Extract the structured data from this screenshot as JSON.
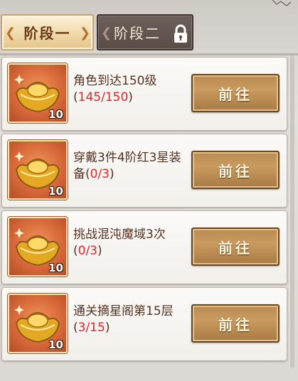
{
  "tabs": [
    {
      "label": "阶段一",
      "active": true,
      "locked": false
    },
    {
      "label": "阶段二",
      "active": false,
      "locked": true
    }
  ],
  "tasks": [
    {
      "text": "角色到达150级",
      "progress_text": "145/150",
      "progress_value": 145,
      "progress_max": 150,
      "reward": {
        "icon": "gold-ingot-icon",
        "count": "10"
      },
      "button": "前往"
    },
    {
      "text": "穿戴3件4阶红3星装备",
      "progress_text": "0/3",
      "progress_value": 0,
      "progress_max": 3,
      "reward": {
        "icon": "gold-ingot-icon",
        "count": "10"
      },
      "button": "前往"
    },
    {
      "text": "挑战混沌魔域3次",
      "progress_text": "0/3",
      "progress_value": 0,
      "progress_max": 3,
      "reward": {
        "icon": "gold-ingot-icon",
        "count": "10"
      },
      "button": "前往"
    },
    {
      "text": "通关摘星阁第15层",
      "progress_text": "3/15",
      "progress_value": 3,
      "progress_max": 15,
      "reward": {
        "icon": "gold-ingot-icon",
        "count": "10"
      },
      "button": "前往"
    }
  ],
  "colors": {
    "progress": "#e0252a",
    "task_text": "#553322",
    "tab_active_bg": "#f0d9a8",
    "tab_locked_bg": "#5a4d48",
    "button_bg": "#b98a52"
  }
}
